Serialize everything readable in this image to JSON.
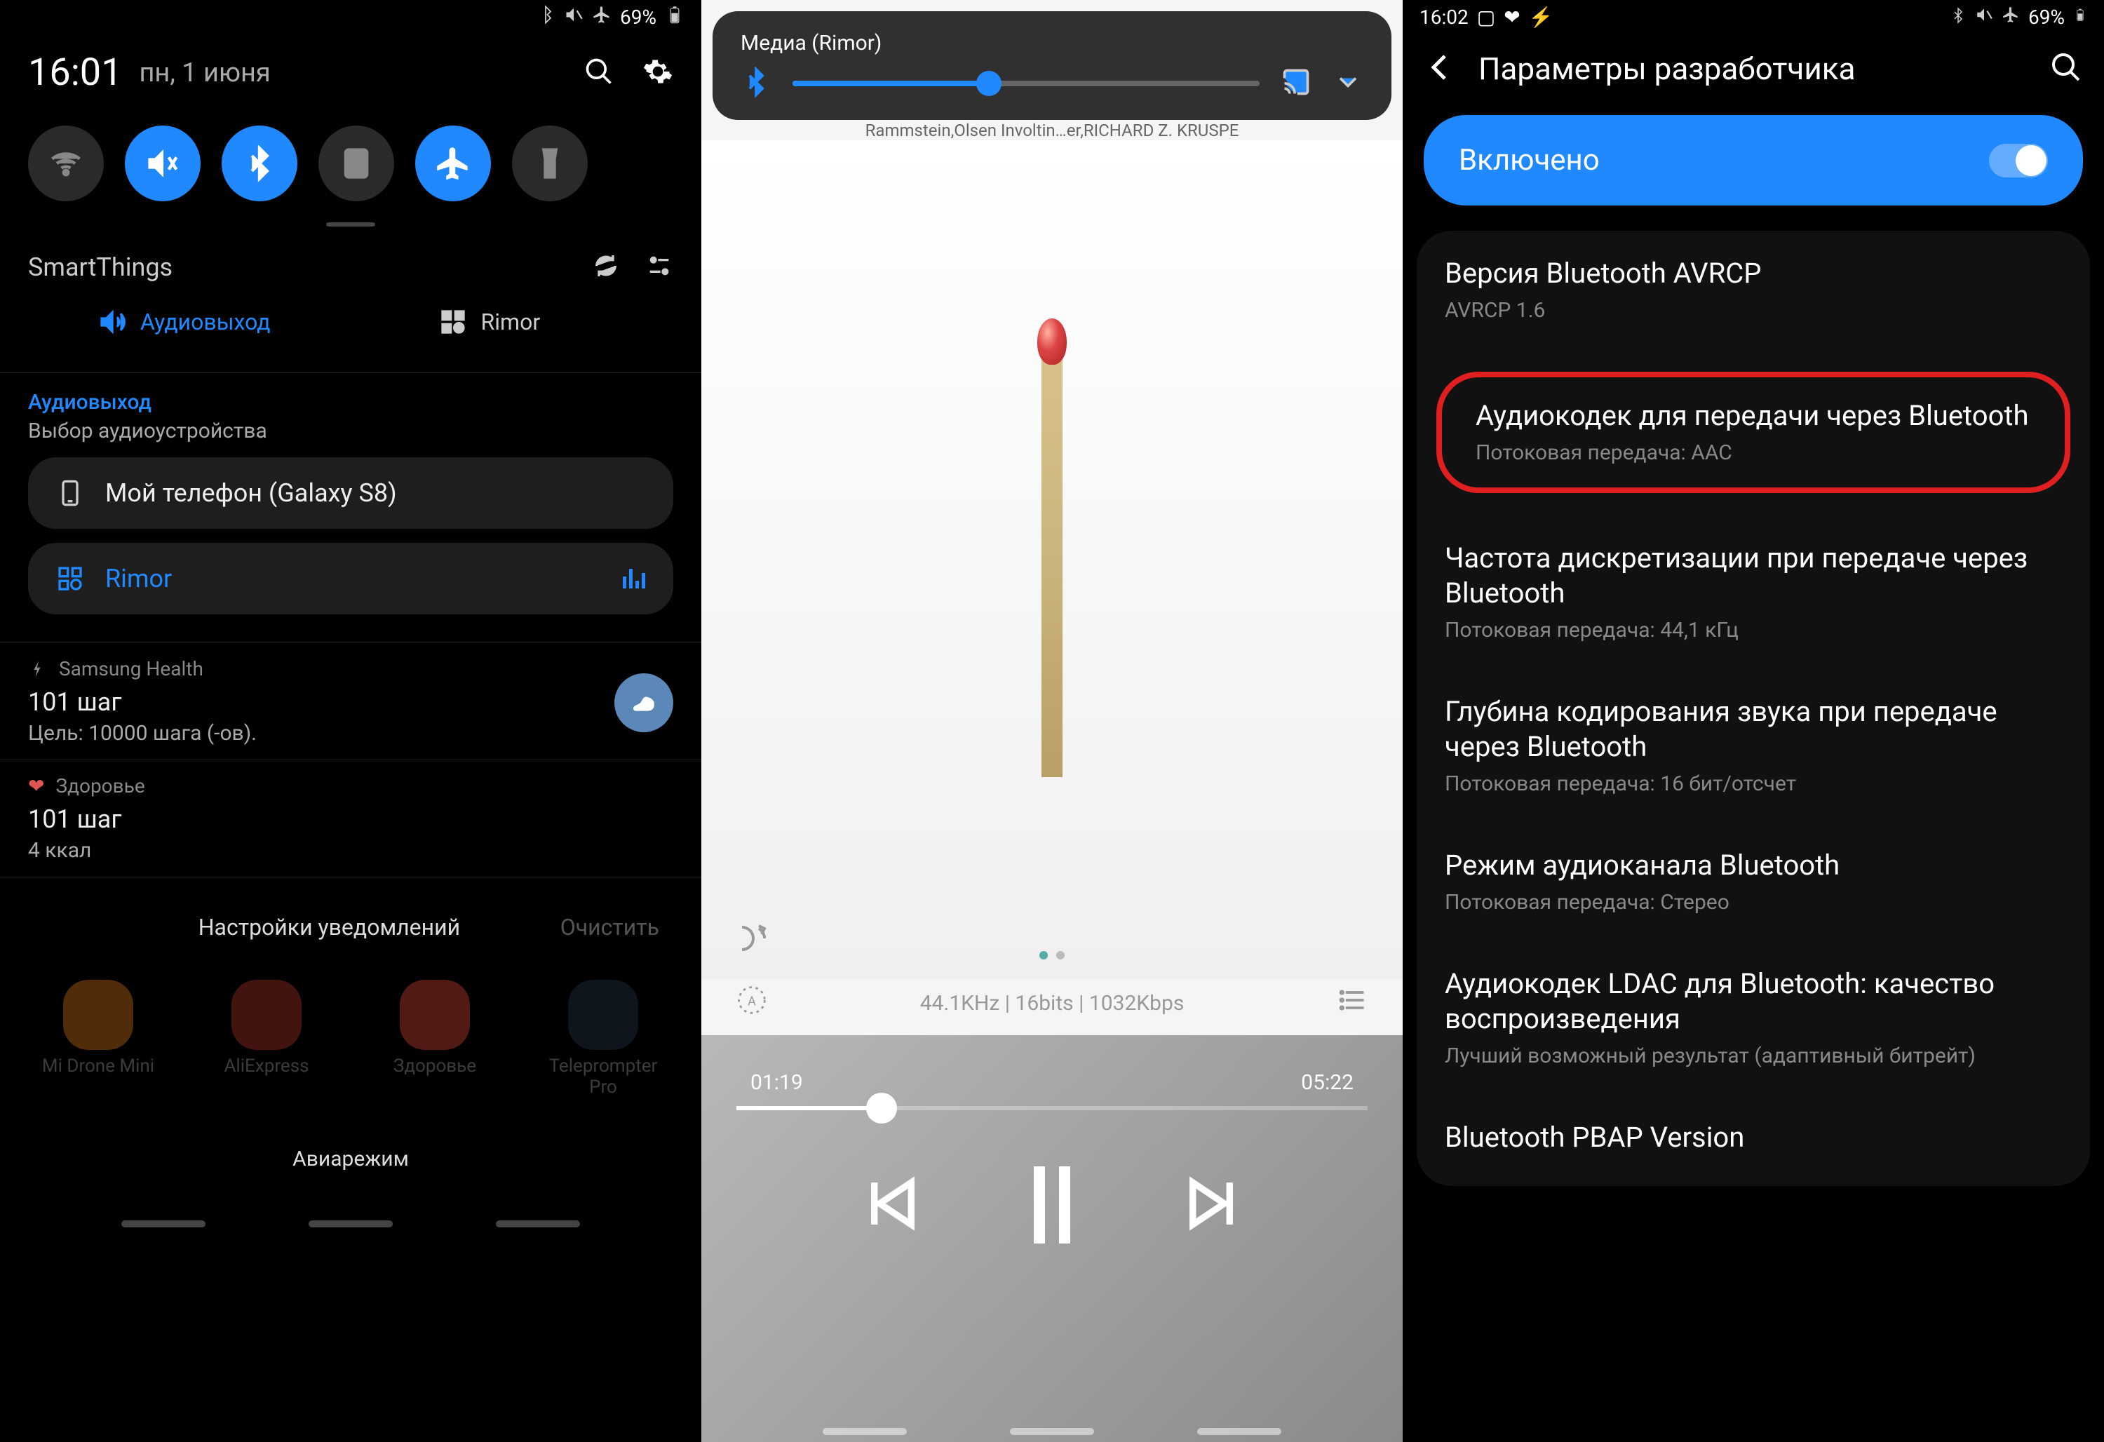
{
  "panel1": {
    "status": {
      "battery": "69%"
    },
    "time": "16:01",
    "date": "пн, 1 июня",
    "smartthings": {
      "title": "SmartThings",
      "audio_output": "Аудиовыход",
      "rimor": "Rimor"
    },
    "audio": {
      "title": "Аудиовыход",
      "subtitle": "Выбор аудиоустройства",
      "device_phone": "Мой телефон (Galaxy S8)",
      "device_rimor": "Rimor"
    },
    "health": {
      "app": "Samsung Health",
      "title": "101 шаг",
      "goal": "Цель: 10000 шага (-ов)."
    },
    "health2": {
      "app": "Здоровье",
      "title": "101 шаг",
      "cal": "4 ккал"
    },
    "footer": {
      "settings": "Настройки уведомлений",
      "clear": "Очистить"
    },
    "apps": [
      "Mi Drone Mini",
      "AliExpress",
      "Здоровье",
      "Teleprompter Pro"
    ],
    "flight": "Авиарежим"
  },
  "panel2": {
    "media_label": "Медиа (Rimor)",
    "track_artists": "Rammstein,Olsen Involtin…er,RICHARD Z. KRUSPE",
    "audio_info": "44.1KHz | 16bits | 1032Kbps",
    "elapsed": "01:19",
    "duration": "05:22"
  },
  "panel3": {
    "time": "16:02",
    "battery": "69%",
    "header": "Параметры разработчика",
    "enabled": "Включено",
    "items": [
      {
        "title": "Версия Bluetooth AVRCP",
        "sub": "AVRCP 1.6"
      },
      {
        "title": "Аудиокодек для передачи через Bluetooth",
        "sub": "Потоковая передача: AAC"
      },
      {
        "title": "Частота дискретизации при передаче через Bluetooth",
        "sub": "Потоковая передача: 44,1 кГц"
      },
      {
        "title": "Глубина кодирования звука при передаче через Bluetooth",
        "sub": "Потоковая передача: 16 бит/отсчет"
      },
      {
        "title": "Режим аудиоканала Bluetooth",
        "sub": "Потоковая передача: Стерео"
      },
      {
        "title": "Аудиокодек LDAC для Bluetooth: качество воспроизведения",
        "sub": "Лучший возможный результат (адаптивный битрейт)"
      },
      {
        "title": "Bluetooth PBAP Version",
        "sub": ""
      }
    ]
  }
}
